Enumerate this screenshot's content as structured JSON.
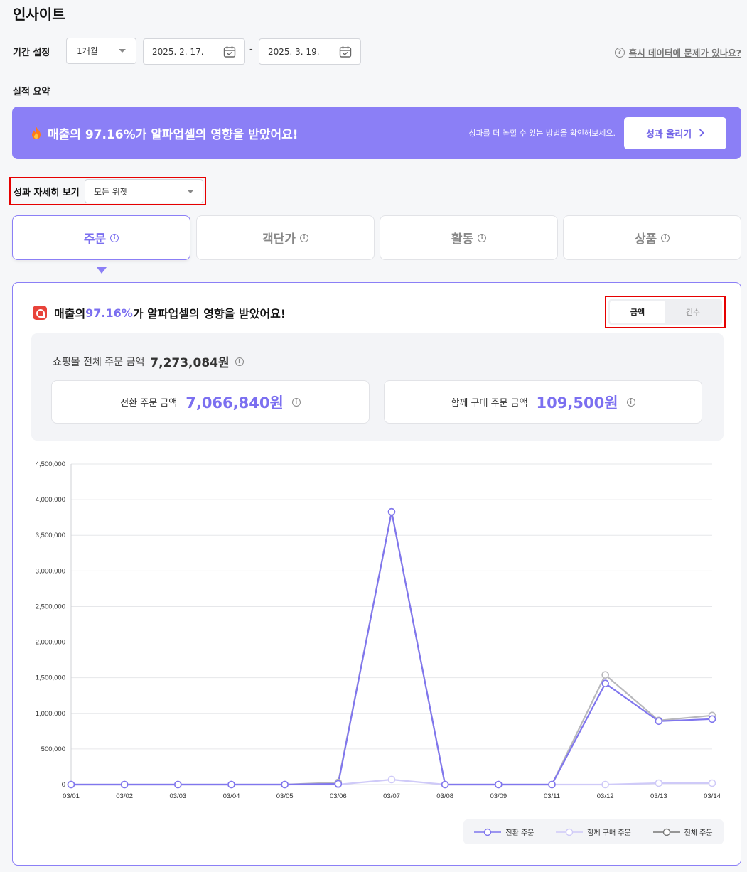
{
  "page_title": "인사이트",
  "period": {
    "label": "기간 설정",
    "selected": "1개월",
    "start_date": "2025. 2. 17.",
    "end_date": "2025. 3. 19.",
    "dash": "-"
  },
  "help_link": "혹시 데이터에 문제가 있나요?",
  "summary_label": "실적 요약",
  "banner": {
    "title": "매출의 97.16%가 알파업셀의 영향을 받았어요!",
    "subtitle": "성과를 더 높힐 수 있는 방법을 확인해보세요.",
    "button": "성과 올리기"
  },
  "detail": {
    "label": "성과 자세히 보기",
    "widget_selected": "모든 위젯"
  },
  "tabs": [
    {
      "label": "주문",
      "active": true
    },
    {
      "label": "객단가",
      "active": false
    },
    {
      "label": "활동",
      "active": false
    },
    {
      "label": "상품",
      "active": false
    }
  ],
  "panel": {
    "title_prefix": "매출의 ",
    "title_highlight": "97.16%",
    "title_suffix": "가 알파업셀의 영향을 받았어요!",
    "toggle": [
      "금액",
      "건수"
    ],
    "total_label": "쇼핑몰 전체 주문 금액",
    "total_value": "7,273,084원",
    "conv_label": "전환 주문 금액",
    "conv_value": "7,066,840원",
    "cross_label": "함께 구매 주문 금액",
    "cross_value": "109,500원"
  },
  "chart_data": {
    "type": "line",
    "x": [
      "03/01",
      "03/02",
      "03/03",
      "03/04",
      "03/05",
      "03/06",
      "03/07",
      "03/08",
      "03/09",
      "03/11",
      "03/12",
      "03/13",
      "03/14"
    ],
    "yticks": [
      "0",
      "500,000",
      "1,000,000",
      "1,500,000",
      "2,000,000",
      "2,500,000",
      "3,000,000",
      "3,500,000",
      "4,000,000",
      "4,500,000"
    ],
    "ylim": [
      0,
      4500000
    ],
    "grid": true,
    "legend_position": "bottom-right",
    "series": [
      {
        "name": "전체 주문",
        "color": "#b8b8bc",
        "values": [
          0,
          0,
          0,
          0,
          0,
          30000,
          3830000,
          0,
          0,
          0,
          1540000,
          900000,
          970000
        ]
      },
      {
        "name": "함께 구매 주문",
        "color": "#cfcaf8",
        "values": [
          0,
          0,
          0,
          0,
          0,
          0,
          70000,
          0,
          0,
          0,
          0,
          20000,
          20000
        ]
      },
      {
        "name": "전환 주문",
        "color": "#8076ee",
        "values": [
          0,
          0,
          0,
          0,
          0,
          10000,
          3830000,
          0,
          0,
          0,
          1420000,
          890000,
          920000
        ]
      }
    ]
  }
}
